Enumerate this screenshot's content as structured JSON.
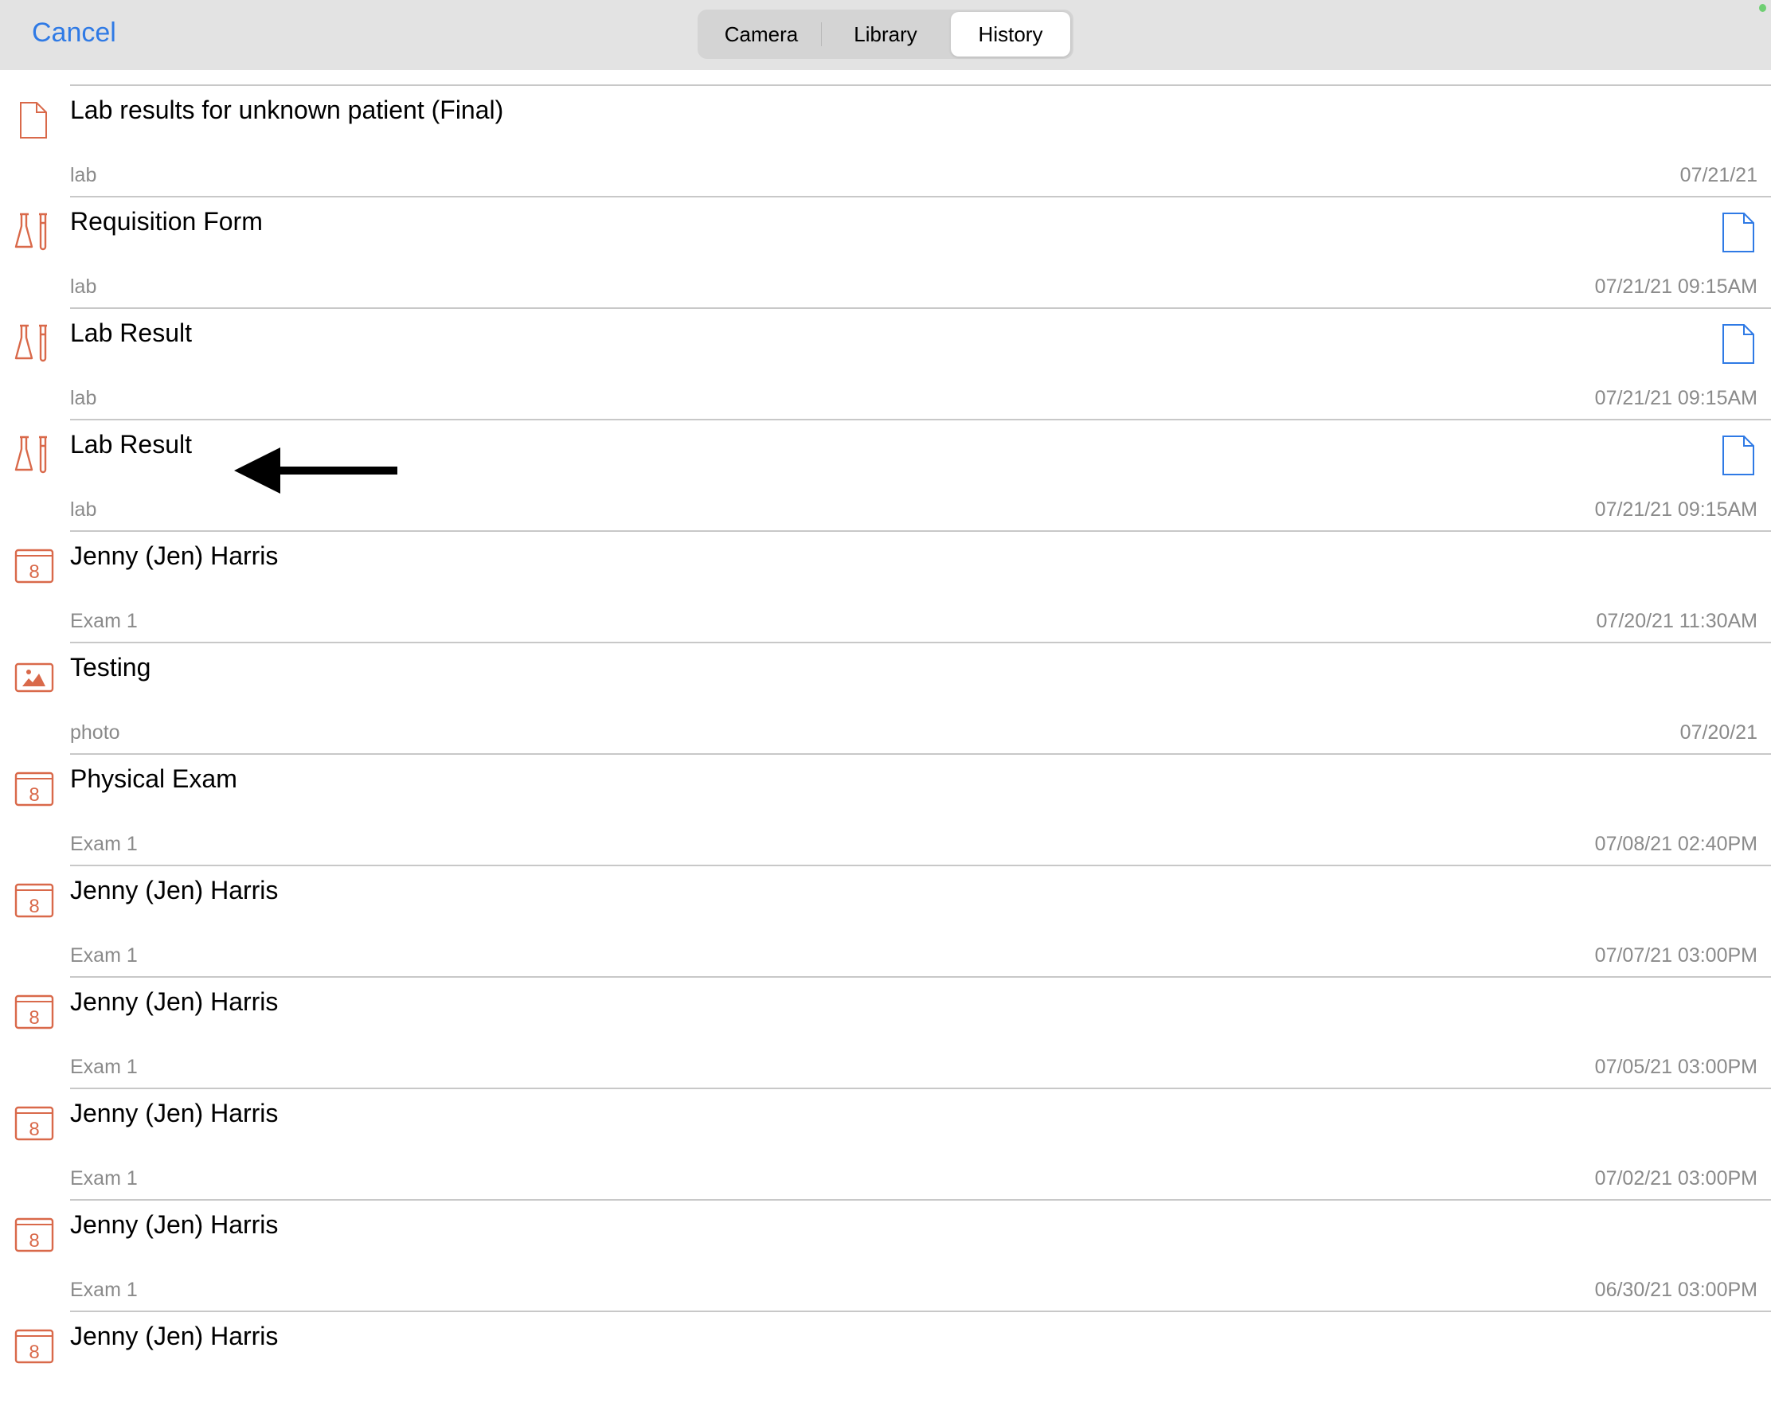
{
  "topbar": {
    "cancel_label": "Cancel",
    "segments": [
      "Camera",
      "Library",
      "History"
    ],
    "selected_segment": "History"
  },
  "colors": {
    "accent": "#2f7ae5",
    "icon": "#d9694a",
    "doc_icon": "#2f7ae5",
    "status_dot": "#6fcf73"
  },
  "items": [
    {
      "title": "",
      "subtitle": "Exam 1",
      "date": "07/21/21 09:15AM",
      "icon": "calendar-icon",
      "doc": false
    },
    {
      "title": "Lab results for unknown patient (Final)",
      "subtitle": "lab",
      "date": "07/21/21",
      "icon": "document-icon",
      "doc": false
    },
    {
      "title": "Requisition Form",
      "subtitle": "lab",
      "date": "07/21/21 09:15AM",
      "icon": "lab-flask-icon",
      "doc": true
    },
    {
      "title": "Lab Result",
      "subtitle": "lab",
      "date": "07/21/21 09:15AM",
      "icon": "lab-flask-icon",
      "doc": true
    },
    {
      "title": "Lab Result",
      "subtitle": "lab",
      "date": "07/21/21 09:15AM",
      "icon": "lab-flask-icon",
      "doc": true
    },
    {
      "title": "Jenny (Jen) Harris",
      "subtitle": "Exam 1",
      "date": "07/20/21 11:30AM",
      "icon": "calendar-icon",
      "doc": false
    },
    {
      "title": "Testing",
      "subtitle": "photo",
      "date": "07/20/21",
      "icon": "photo-icon",
      "doc": false
    },
    {
      "title": "Physical Exam",
      "subtitle": "Exam 1",
      "date": "07/08/21 02:40PM",
      "icon": "calendar-icon",
      "doc": false
    },
    {
      "title": "Jenny (Jen) Harris",
      "subtitle": "Exam 1",
      "date": "07/07/21 03:00PM",
      "icon": "calendar-icon",
      "doc": false
    },
    {
      "title": "Jenny (Jen) Harris",
      "subtitle": "Exam 1",
      "date": "07/05/21 03:00PM",
      "icon": "calendar-icon",
      "doc": false
    },
    {
      "title": "Jenny (Jen) Harris",
      "subtitle": "Exam 1",
      "date": "07/02/21 03:00PM",
      "icon": "calendar-icon",
      "doc": false
    },
    {
      "title": "Jenny (Jen) Harris",
      "subtitle": "Exam 1",
      "date": "06/30/21 03:00PM",
      "icon": "calendar-icon",
      "doc": false
    },
    {
      "title": "Jenny (Jen) Harris",
      "subtitle": "",
      "date": "",
      "icon": "calendar-icon",
      "doc": false
    }
  ]
}
